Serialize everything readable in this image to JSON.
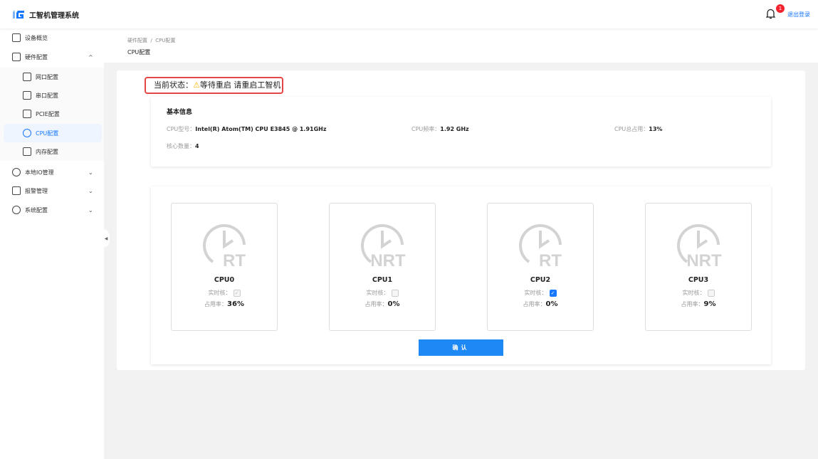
{
  "app": {
    "title": "工智机管理系统",
    "notification_count": "1",
    "logout": "退出登录"
  },
  "sidebar": {
    "items": [
      {
        "label": "设备概览"
      },
      {
        "label": "硬件配置",
        "chevron": "^"
      },
      {
        "label": "网口配置"
      },
      {
        "label": "串口配置"
      },
      {
        "label": "PCIE配置"
      },
      {
        "label": "CPU配置"
      },
      {
        "label": "内存配置"
      },
      {
        "label": "本地IO管理",
        "chevron": "⌄"
      },
      {
        "label": "报警管理",
        "chevron": "⌄"
      },
      {
        "label": "系统配置",
        "chevron": "⌄"
      }
    ]
  },
  "breadcrumb": {
    "path": "硬件配置  /  CPU配置",
    "title": "CPU配置"
  },
  "status": {
    "label": "当前状态：",
    "icon": "⚠",
    "text": "等待重启 请重启工智机"
  },
  "info": {
    "title": "基本信息",
    "model_label": "CPU型号：",
    "model": "Intel(R) Atom(TM) CPU E3845 @ 1.91GHz",
    "freq_label": "CPU频率：",
    "freq": "1.92 GHz",
    "usage_label": "CPU总占用：",
    "usage": "13%",
    "cores_label": "核心数量：",
    "cores": "4"
  },
  "cpus": [
    {
      "name": "CPU0",
      "type": "RT",
      "rt_label": "实时核：",
      "realtime": true,
      "disabled": true,
      "usage_label": "占用率：",
      "usage": "36%"
    },
    {
      "name": "CPU1",
      "type": "NRT",
      "rt_label": "实时核：",
      "realtime": false,
      "disabled": true,
      "usage_label": "占用率：",
      "usage": "0%"
    },
    {
      "name": "CPU2",
      "type": "RT",
      "rt_label": "实时核：",
      "realtime": true,
      "disabled": false,
      "usage_label": "占用率：",
      "usage": "0%"
    },
    {
      "name": "CPU3",
      "type": "NRT",
      "rt_label": "实时核：",
      "realtime": false,
      "disabled": true,
      "usage_label": "占用率：",
      "usage": "9%"
    }
  ],
  "confirm_label": "确认",
  "colors": {
    "accent": "#1677ff",
    "button": "#1e88f5",
    "alert_border": "#e54545"
  }
}
